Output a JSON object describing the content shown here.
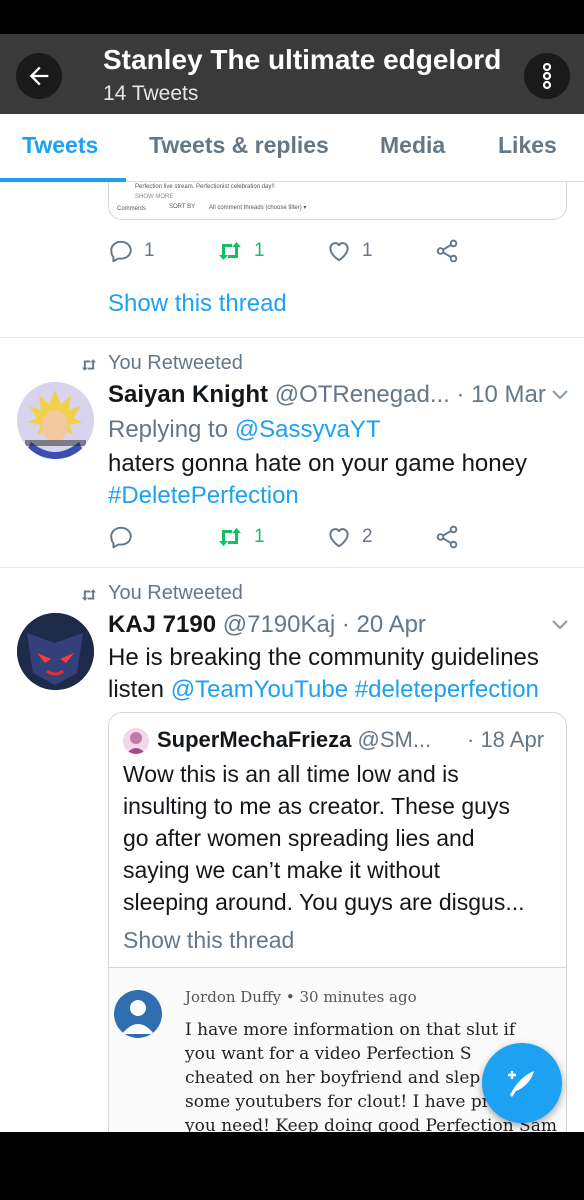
{
  "header": {
    "title": "Stanley The ultimate edgelord",
    "subtitle": "14 Tweets",
    "back_icon": "arrow-left-icon",
    "more_icon": "more-vertical-icon",
    "bar_color": "#3a3a3a"
  },
  "tabs": [
    {
      "label": "Tweets",
      "active": true
    },
    {
      "label": "Tweets & replies",
      "active": false
    },
    {
      "label": "Media",
      "active": false
    },
    {
      "label": "Likes",
      "active": false
    }
  ],
  "accent_color": "#1da1f2",
  "retweet_color": "#17bf63",
  "tweet0": {
    "embed_text_1": "Perfection live stream. Perfectionist celebration day!!",
    "embed_text_2": "SHOW MORE",
    "embed_text_3": "Comments",
    "embed_text_4": "SORT BY",
    "embed_text_5": "All comment threads (choose filter) ▾",
    "replies": "1",
    "retweets": "1",
    "likes": "1",
    "show_thread": "Show this thread"
  },
  "tweet1": {
    "retweet_label": "You Retweeted",
    "name": "Saiyan Knight",
    "handle": "@OTRenegad...",
    "time": "· 10 Mar",
    "replying_to_prefix": "Replying to",
    "replying_to_handle": "@SassyvaYT",
    "text_line1": "haters gonna hate on your game honey",
    "hashtag": "#DeletePerfection",
    "retweets": "1",
    "likes": "2"
  },
  "tweet2": {
    "retweet_label": "You Retweeted",
    "name": "KAJ 7190",
    "handle": "@7190Kaj",
    "time": "· 20 Apr",
    "text_line1": "He is breaking the community guidelines",
    "text_line2_prefix": "listen",
    "mention": "@TeamYouTube",
    "hashtag": "#deleteperfection",
    "quote": {
      "name": "SuperMechaFrieza",
      "handle": "@SM...",
      "time": "· 18 Apr",
      "lines": [
        "Wow this is an all time low and is",
        "insulting to me as creator.  These guys",
        "go after women spreading lies and",
        "saying we can’t make it without",
        "sleeping around. You guys are disgus..."
      ],
      "show_thread": "Show this thread",
      "comment_author": "Jordon Duffy",
      "comment_time": "• 30 minutes ago",
      "comment_lines": [
        "I have more information on that slut if",
        "you want for a video Perfection S",
        "cheated on her boyfriend and slep",
        "some youtubers for clout! I have pr      If",
        "you need! Keep doing good Perfection Sam"
      ]
    }
  },
  "fab_icon": "compose-feather-icon"
}
